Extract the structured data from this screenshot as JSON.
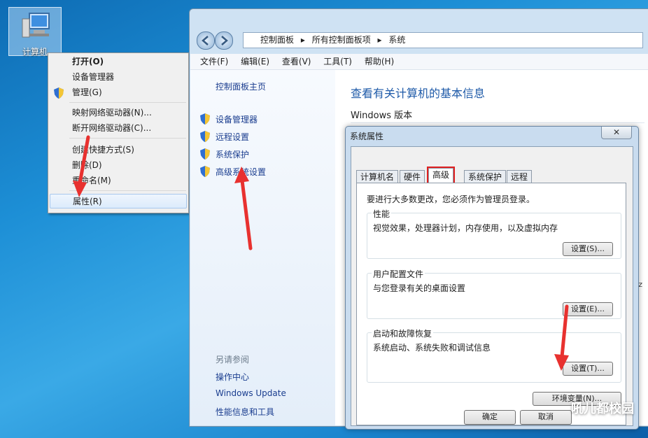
{
  "desktop": {
    "computer_label": "计算机"
  },
  "context_menu": {
    "items": [
      "打开(O)",
      "设备管理器",
      "管理(G)",
      "映射网络驱动器(N)...",
      "断开网络驱动器(C)...",
      "创建快捷方式(S)",
      "删除(D)",
      "重命名(M)",
      "属性(R)"
    ]
  },
  "breadcrumb": [
    "控制面板",
    "所有控制面板项",
    "系统"
  ],
  "menubar": [
    "文件(F)",
    "编辑(E)",
    "查看(V)",
    "工具(T)",
    "帮助(H)"
  ],
  "left_pane": {
    "home": "控制面板主页",
    "links": [
      "设备管理器",
      "远程设置",
      "系统保护",
      "高级系统设置"
    ],
    "see_also_title": "另请参阅",
    "see_also": [
      "操作中心",
      "Windows Update",
      "性能信息和工具"
    ]
  },
  "main": {
    "title": "查看有关计算机的基本信息",
    "windows_edition": "Windows 版本",
    "partial_right": "Iz"
  },
  "dialog": {
    "title": "系统属性",
    "tabs": [
      "计算机名",
      "硬件",
      "高级",
      "系统保护",
      "远程"
    ],
    "active_tab": "高级",
    "admin_note": "要进行大多数更改，您必须作为管理员登录。",
    "performance": {
      "title": "性能",
      "desc": "视觉效果，处理器计划，内存使用，以及虚拟内存",
      "button": "设置(S)..."
    },
    "profiles": {
      "title": "用户配置文件",
      "desc": "与您登录有关的桌面设置",
      "button": "设置(E)..."
    },
    "startup": {
      "title": "启动和故障恢复",
      "desc": "系统启动、系统失败和调试信息",
      "button": "设置(T)..."
    },
    "env_button": "环境变量(N)...",
    "ok": "确定",
    "cancel": "取消"
  },
  "watermark": "吼儿都校园",
  "colors": {
    "arrow": "#e8312f",
    "highlight_box": "#e02020",
    "link": "#1a3d8f",
    "title_blue": "#1e5aa8"
  }
}
